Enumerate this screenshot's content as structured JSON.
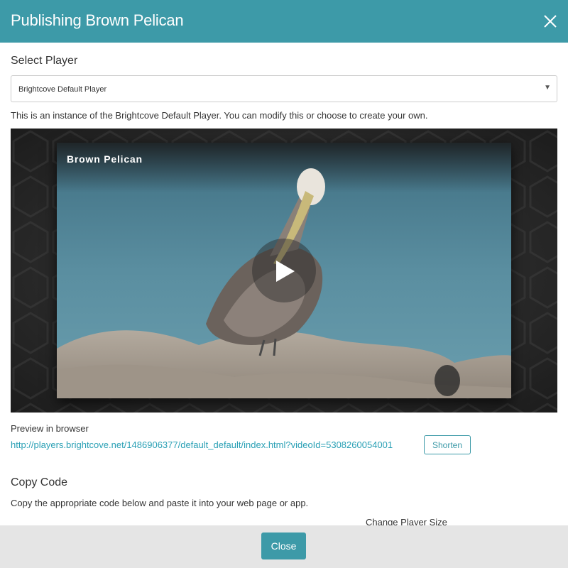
{
  "header": {
    "title": "Publishing Brown Pelican"
  },
  "select_player": {
    "heading": "Select Player",
    "selected": "Brightcove Default Player",
    "arrow": "▼",
    "info": "This is an instance of the Brightcove Default Player. You can modify this or choose to create your own."
  },
  "video": {
    "title": "Brown Pelican"
  },
  "preview": {
    "label": "Preview in browser",
    "url": "http://players.brightcove.net/1486906377/default_default/index.html?videoId=5308260054001",
    "shorten_label": "Shorten"
  },
  "copy_code": {
    "heading": "Copy Code",
    "description": "Copy the appropriate code below and paste it into your web page or app.",
    "change_size_label": "Change Player Size"
  },
  "footer": {
    "close_label": "Close"
  },
  "colors": {
    "accent": "#3d9aa8",
    "link": "#2aa0b5",
    "footer_bg": "#e5e5e5"
  }
}
